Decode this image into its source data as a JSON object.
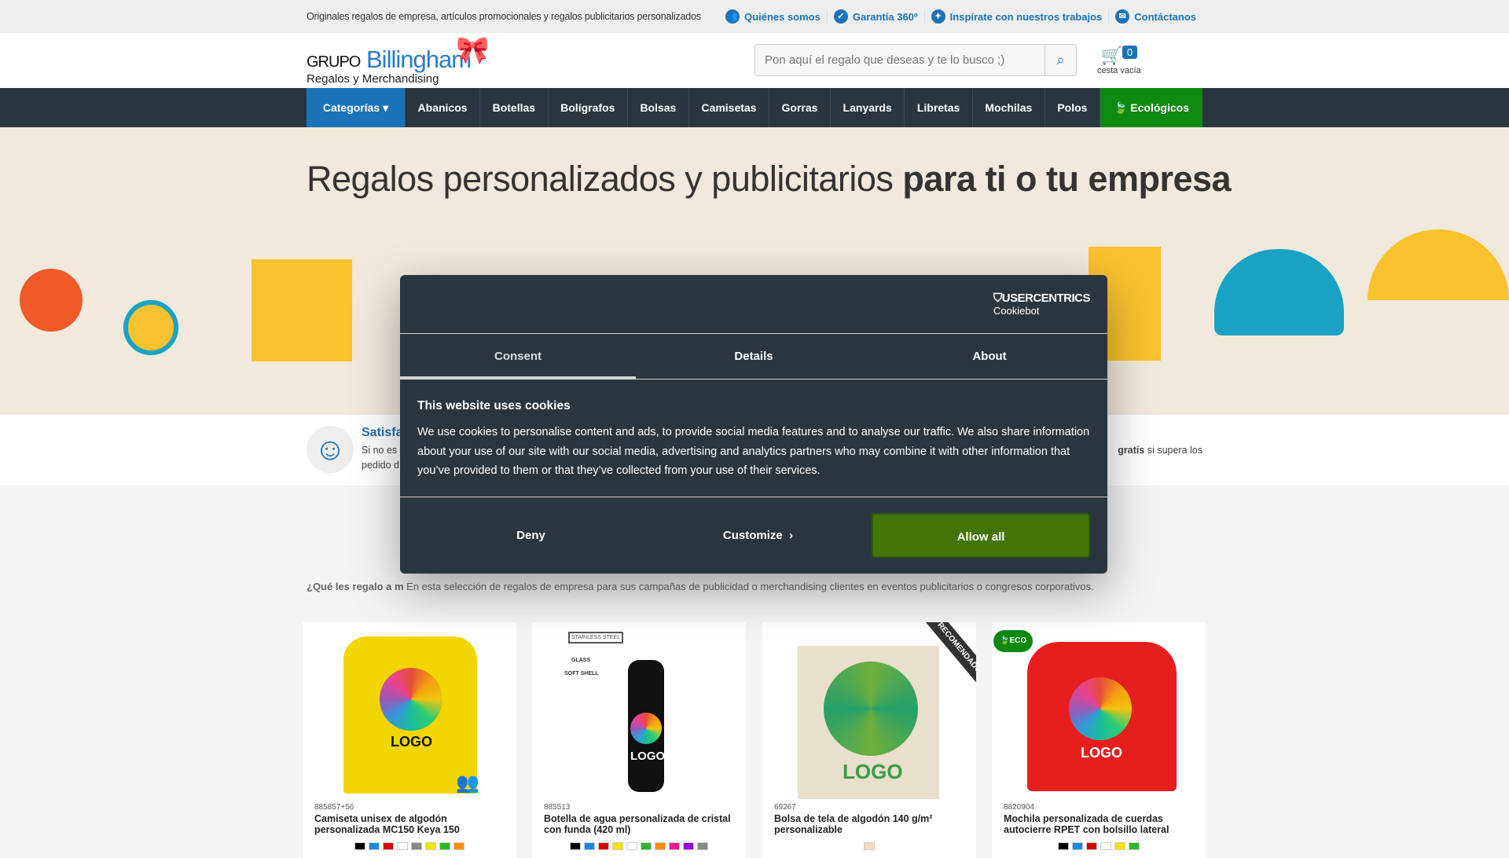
{
  "topbar": {
    "tagline": "Originales regalos de empresa, artículos promocionales y regalos publicitarios personalizados",
    "links": [
      {
        "label": "Quiénes somos",
        "icon": "users-icon"
      },
      {
        "label": "Garantía 360º",
        "icon": "shield-icon"
      },
      {
        "label": "Inspírate con nuestros trabajos",
        "icon": "idea-icon"
      },
      {
        "label": "Contáctanos",
        "icon": "mail-icon"
      }
    ]
  },
  "header": {
    "logo": {
      "grupo": "GRUPO",
      "brand": "Billingham",
      "sub": "Regalos y Merchandising"
    },
    "search_placeholder": "Pon aquí el regalo que deseas y te lo busco ;)",
    "cart": {
      "count": "0",
      "label": "cesta vacía"
    }
  },
  "nav": {
    "items": [
      "Categorías ▾",
      "Abanicos",
      "Botellas",
      "Bolígrafos",
      "Bolsas",
      "Camisetas",
      "Gorras",
      "Lanyards",
      "Libretas",
      "Mochilas",
      "Polos",
      "Ecológicos"
    ]
  },
  "hero": {
    "title_light": "Regalos personalizados y publicitarios ",
    "title_bold": "para ti o tu empresa"
  },
  "strip": {
    "title": "Satisfa",
    "line1": "Si no es",
    "line2": "pedido d",
    "right_bold": "gratis",
    "right_rest": " si supera los"
  },
  "intro": {
    "lead": "¿Qué les regalo a m",
    "text": "En esta selección de regalos de empresa para sus campañas de publicidad o merchandising clientes en eventos publicitarios o congresos corporativos."
  },
  "products": [
    {
      "code": "885857+56",
      "name": "Camiseta unisex de algodón personalizada MC150 Keya 150",
      "colors": [
        "#000000",
        "#1e88e5",
        "#d50000",
        "#ffffff",
        "#888888",
        "#f5e400",
        "#2db52d",
        "#ff8c00"
      ]
    },
    {
      "code": "885513",
      "name": "Botella de agua personalizada de cristal con funda (420 ml)",
      "colors": [
        "#000000",
        "#1e88e5",
        "#d50000",
        "#f5e400",
        "#ffffff",
        "#2db52d",
        "#ff8c00",
        "#e91e8c",
        "#9c00d6",
        "#888888"
      ],
      "labels": [
        "STAINLESS STEEL",
        "GLASS",
        "SOFT SHELL"
      ]
    },
    {
      "code": "69267",
      "name": "Bolsa de tela de algodón 140 g/m² personalizable",
      "colors": [
        "#f5dcc0"
      ],
      "ribbon": "RECOMENDADO"
    },
    {
      "code": "8820904",
      "name": "Mochila personalizada de cuerdas autocierre RPET con bolsillo lateral",
      "colors": [
        "#000000",
        "#1e88e5",
        "#d50000",
        "#ffffff",
        "#f5e400",
        "#2db52d"
      ],
      "badge": "ECO"
    }
  ],
  "logo_text": "LOGO",
  "cookie": {
    "brand": "USERCENTRICS",
    "brand_sub": "Cookiebot",
    "tabs": [
      "Consent",
      "Details",
      "About"
    ],
    "active_tab": "Consent",
    "title": "This website uses cookies",
    "body": "We use cookies to personalise content and ads, to provide social media features and to analyse our traffic. We also share information about your use of our site with our social media, advertising and analytics partners who may combine it with other information that you’ve provided to them or that they’ve collected from your use of their services.",
    "deny": "Deny",
    "customize": "Customize",
    "allow": "Allow all"
  },
  "colors": {
    "primary": "#1a73b8",
    "nav": "#293640",
    "eco": "#0e8a12",
    "allow": "#437405"
  }
}
